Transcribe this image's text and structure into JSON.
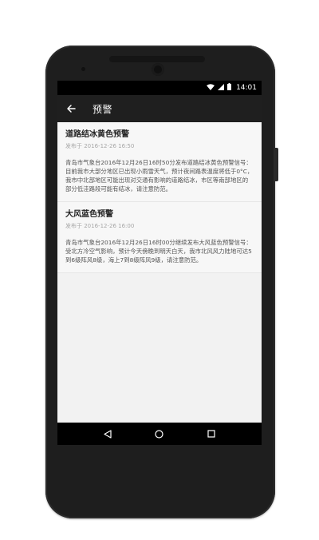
{
  "status_bar": {
    "time": "14:01",
    "icons": [
      "wifi-icon",
      "signal-icon",
      "battery-icon"
    ]
  },
  "toolbar": {
    "title": "预警",
    "back_icon": "back-arrow-icon"
  },
  "warnings": [
    {
      "title": "道路结冰黄色预警",
      "time": "发布于 2016-12-26 16:50",
      "body": "青岛市气象台2016年12月26日16时50分发布道路结冰黄色预警信号：目前我市大部分地区已出现小雨雪天气，预计夜间路表温度将低于0°C，我市中北部地区可能出现对交通有影响的道路结冰，市区等南部地区的部分低洼路段可能有结冰，请注意防范。"
    },
    {
      "title": "大风蓝色预警",
      "time": "发布于 2016-12-26 16:00",
      "body": "青岛市气象台2016年12月26日16时00分继续发布大风蓝色预警信号：受北方冷空气影响，预计今天傍晚到明天白天，我市北风风力陆地可达5到6级阵风8级，海上7到8级阵风9级，请注意防范。"
    }
  ],
  "nav_bar": {
    "buttons": [
      "back-triangle-icon",
      "home-circle-icon",
      "recents-square-icon"
    ]
  },
  "colors": {
    "toolbar": "#1f1f1f",
    "status_bar": "#000000",
    "card_background": "#f7f7f7",
    "phone_body": "#1e1e1e"
  }
}
